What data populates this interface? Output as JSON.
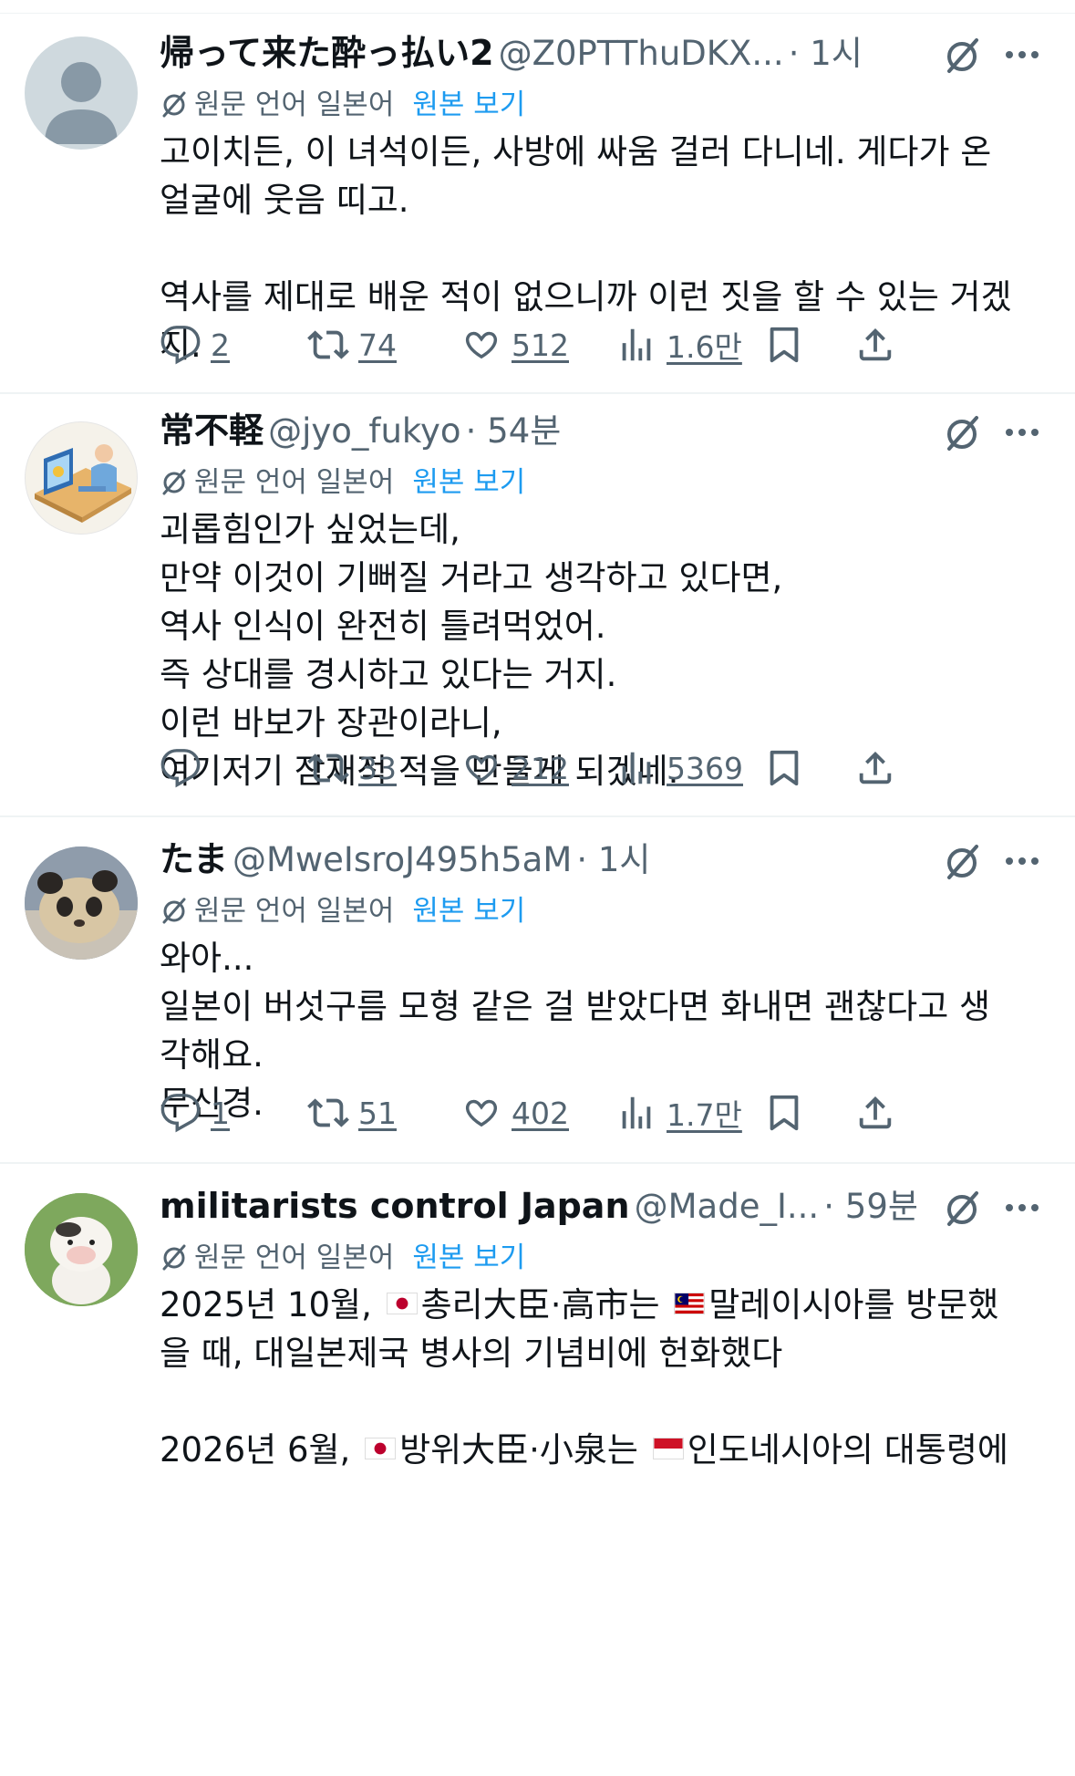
{
  "labels": {
    "translate_note": "원문 언어 일본어",
    "show_original": "원본 보기"
  },
  "colors": {
    "text": "#0f1419",
    "secondary": "#536471",
    "link": "#1d9bf0",
    "divider": "#eff3f4"
  },
  "icons": {
    "reply": "reply-icon",
    "repost": "repost-icon",
    "like": "heart-icon",
    "views": "views-icon",
    "bookmark": "bookmark-icon",
    "share": "share-icon",
    "grok": "grok-icon",
    "more": "more-icon"
  },
  "tweets": [
    {
      "name": "帰って来た酔っ払い2",
      "handle": "@Z0PTThuDKX...",
      "time": "· 1시",
      "lines": [
        "고이치든, 이 녀석이든, 사방에 싸움 걸러 다니네. 게다가 온",
        "얼굴에 웃음 띠고.",
        "",
        "역사를 제대로 배운 적이 없으니까 이런 짓을 할 수 있는 거겠",
        "지."
      ],
      "replies": "2",
      "reposts": "74",
      "likes": "512",
      "views": "1.6만"
    },
    {
      "name": "常不軽",
      "handle": "@jyo_fukyo",
      "time": "· 54분",
      "lines": [
        "괴롭힘인가 싶었는데,",
        "만약 이것이 기뻐질 거라고 생각하고 있다면,",
        "역사 인식이 완전히 틀려먹었어.",
        "즉 상대를 경시하고 있다는 거지.",
        "이런 바보가 장관이라니,",
        "여기저기 잠재적 적을 만들게 되겠네."
      ],
      "replies": "",
      "reposts": "33",
      "likes": "212",
      "views": "5369"
    },
    {
      "name": "たま",
      "handle": "@MweIsroJ495h5aM",
      "time": "· 1시",
      "lines": [
        "와아...",
        "일본이 버섯구름 모형 같은 걸 받았다면 화내면 괜찮다고 생",
        "각해요.",
        "무신경."
      ],
      "replies": "1",
      "reposts": "51",
      "likes": "402",
      "views": "1.7만"
    },
    {
      "name": "militarists control Japan",
      "handle": "@Made_I...",
      "time": "· 59분",
      "line1_a": "2025년 10월, ",
      "line1_b": "총리大臣·高市는 ",
      "line1_c": "말레이시아를 방문했",
      "line2": "을 때, 대일본제국 병사의 기념비에 헌화했다",
      "line3_a": "2026년 6월, ",
      "line3_b": "방위大臣·小泉는 ",
      "line3_c": "인도네시아의 대통령에"
    }
  ]
}
